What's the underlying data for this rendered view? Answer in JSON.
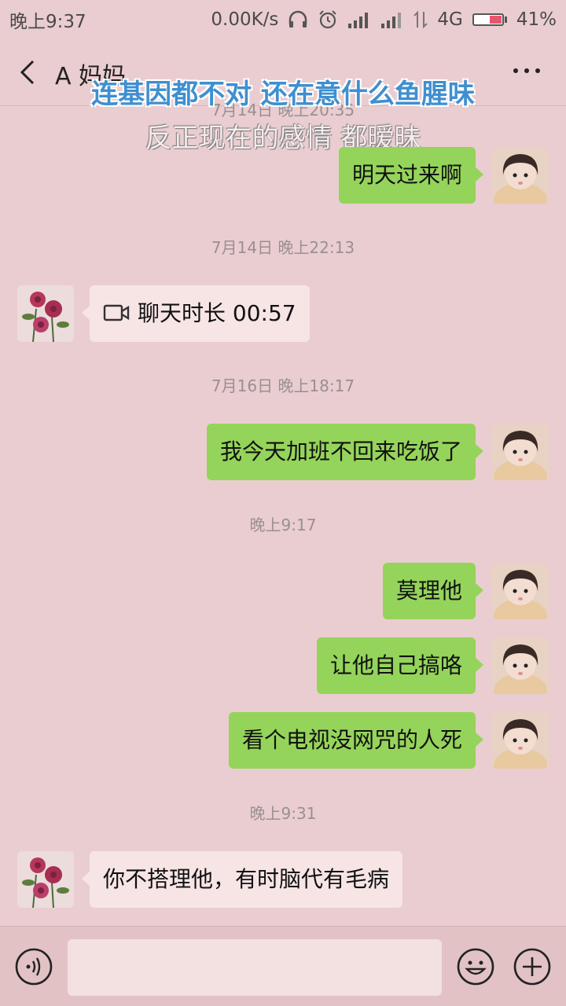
{
  "status_bar": {
    "time": "晚上9:37",
    "speed": "0.00K/s",
    "network": "4G",
    "battery": "41%"
  },
  "nav": {
    "title": "A 妈妈"
  },
  "overlay": {
    "line1": "连基因都不对 还在意什么鱼腥味",
    "line2": "反正现在的感情 都暧昧",
    "hidden_time": "7月14日 晚上20:35"
  },
  "messages": [
    {
      "side": "right",
      "text": "明天过来啊"
    },
    {
      "type": "time",
      "text": "7月14日 晚上22:13"
    },
    {
      "side": "left",
      "text": "聊天时长 00:57",
      "icon": "video-call-icon"
    },
    {
      "type": "time",
      "text": "7月16日 晚上18:17"
    },
    {
      "side": "right",
      "text": "我今天加班不回来吃饭了"
    },
    {
      "type": "time",
      "text": "晚上9:17"
    },
    {
      "side": "right",
      "text": "莫理他"
    },
    {
      "side": "right",
      "text": "让他自己搞咯"
    },
    {
      "side": "right",
      "text": "看个电视没网咒的人死"
    },
    {
      "type": "time",
      "text": "晚上9:31"
    },
    {
      "side": "left",
      "text": "你不搭理他，有时脑代有毛病"
    }
  ],
  "colors": {
    "background": "#eacdd0",
    "right_bubble": "#95d45a",
    "left_bubble": "#f7e5e6",
    "lyric_blue": "#3f8fd0"
  }
}
